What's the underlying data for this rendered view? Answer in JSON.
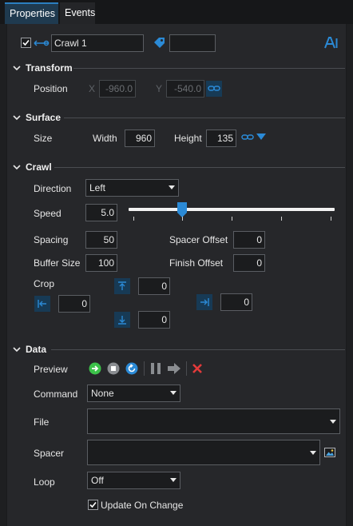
{
  "tabs": [
    {
      "label": "Properties"
    },
    {
      "label": "Events"
    }
  ],
  "header": {
    "name_value": "Crawl 1",
    "tag_value": ""
  },
  "transform": {
    "title": "Transform",
    "position_label": "Position",
    "x_label": "X",
    "x_value": "-960.0",
    "y_label": "Y",
    "y_value": "-540.0"
  },
  "surface": {
    "title": "Surface",
    "size_label": "Size",
    "width_label": "Width",
    "width_value": "960",
    "height_label": "Height",
    "height_value": "135"
  },
  "crawl": {
    "title": "Crawl",
    "direction_label": "Direction",
    "direction_value": "Left",
    "speed_label": "Speed",
    "speed_value": "5.0",
    "speed_slider_fraction": 0.26,
    "spacing_label": "Spacing",
    "spacing_value": "50",
    "spacer_offset_label": "Spacer Offset",
    "spacer_offset_value": "0",
    "buffer_label": "Buffer Size",
    "buffer_value": "100",
    "finish_offset_label": "Finish Offset",
    "finish_offset_value": "0",
    "crop_label": "Crop",
    "crop_top": "0",
    "crop_left": "0",
    "crop_right": "0",
    "crop_bottom": "0"
  },
  "data": {
    "title": "Data",
    "preview_label": "Preview",
    "command_label": "Command",
    "command_value": "None",
    "file_label": "File",
    "file_value": "",
    "spacer_label": "Spacer",
    "spacer_value": "",
    "loop_label": "Loop",
    "loop_value": "Off",
    "update_label": "Update On Change"
  },
  "colors": {
    "accent": "#2b8ad6",
    "play": "#3cc24a",
    "stop": "#8a8d91",
    "delete": "#e23a3a"
  }
}
